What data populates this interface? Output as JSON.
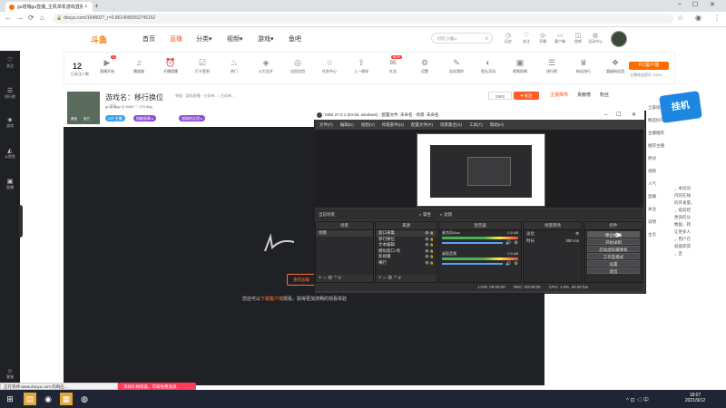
{
  "browser": {
    "tab_title": "gu塔瑞gu直播_主机单机游戏直播",
    "tab_close": "×",
    "new_tab": "+",
    "url": "douyu.com/164802?_r=0.8614950552745152",
    "win_min": "–",
    "win_max": "☐",
    "win_close": "✕"
  },
  "sidebar": {
    "items": [
      {
        "label": "关注",
        "icon": "heart-icon"
      },
      {
        "label": "排行榜",
        "icon": "rank-icon"
      },
      {
        "label": "游戏",
        "icon": "game-icon"
      },
      {
        "label": "斗鱼鱼",
        "icon": "fish-icon"
      },
      {
        "label": "直播",
        "icon": "live-icon"
      },
      {
        "label": "客服",
        "icon": "service-icon"
      }
    ]
  },
  "header": {
    "logo": "斗鱼",
    "nav": [
      "首页",
      "直播",
      "分类▾",
      "视频▾",
      "游戏▾",
      "鱼吧"
    ],
    "search_placeholder": "好吃小雅ω",
    "icons": [
      {
        "label": "历史",
        "icon": "history-icon"
      },
      {
        "label": "关注",
        "icon": "follow-icon"
      },
      {
        "label": "开播",
        "icon": "broadcast-icon"
      },
      {
        "label": "客户端",
        "icon": "client-icon"
      },
      {
        "label": "鱼吧",
        "icon": "bar-icon"
      },
      {
        "label": "活动中心",
        "icon": "activity-icon"
      }
    ]
  },
  "category_bar": {
    "count": "12",
    "count_caption": "已关注人数",
    "items": [
      {
        "label": "直播开始",
        "badge": "2"
      },
      {
        "label": "播放器",
        "badge": ""
      },
      {
        "label": "开播提醒",
        "badge": ""
      },
      {
        "label": "打卡签到",
        "badge": ""
      },
      {
        "label": "热门",
        "badge": ""
      },
      {
        "label": "火力全开",
        "badge": ""
      },
      {
        "label": "全民应用",
        "badge": ""
      },
      {
        "label": "任务中心",
        "badge": ""
      },
      {
        "label": "上一周排",
        "badge": ""
      },
      {
        "label": "礼包",
        "badge": "NEW"
      },
      {
        "label": "设置",
        "badge": ""
      },
      {
        "label": "告诉我你",
        "badge": ""
      },
      {
        "label": "鱼丸活动",
        "badge": ""
      },
      {
        "label": "视频投稿",
        "badge": ""
      },
      {
        "label": "排行榜",
        "badge": ""
      },
      {
        "label": "粉丝排行",
        "badge": ""
      },
      {
        "label": "超级粉丝团",
        "badge": ""
      }
    ],
    "pc_button": "PC客户端",
    "pc_sub": "主播收益提升 200%"
  },
  "room": {
    "title": "游戏名：移行换位",
    "meta": "举报 · 游戏直播 › 主机单... › 主机单...",
    "tagline": "gu塔瑞gu  ◎ 6400  ♡ 270.4kg",
    "avatar_tags": [
      "原创",
      "官方"
    ],
    "badges": [
      "VIP 主播",
      "捐献勋章 ▸",
      "超级粉丝团 ▸"
    ],
    "fans": "2902",
    "follow": "♥ 关注"
  },
  "player": {
    "reload": "重新加载",
    "tip_prefix": "您还可以",
    "tip_link": "下载客户端",
    "tip_suffix": "观看，获得更加流畅的观看体验",
    "promo": "添加礼物惊喜，可拿免费道具"
  },
  "right_panel": {
    "tabs": [
      "主播推荐",
      "贡献榜",
      "粉丝"
    ],
    "lines": [
      "土豪排行",
      "精选好礼",
      "主播推荐",
      "推荐主播",
      "原创",
      "视频",
      "人气",
      "直播",
      "关注",
      "说明",
      "主页"
    ],
    "text_snippets": [
      "，本房间",
      "内的在线",
      "的开发量，",
      "，提前结",
      "更高的分",
      "数据，转",
      "让更多人",
      "，用户在",
      "就能获得",
      "，且"
    ],
    "sponsor": "挂机"
  },
  "obs": {
    "title": "OBS 27.0.1 (64-bit, windows) - 配置文件: 未命名 - 场景: 未命名",
    "menu": [
      "文件(F)",
      "编辑(E)",
      "视图(V)",
      "停靠部件(D)",
      "配置文件(P)",
      "场景集合(S)",
      "工具(T)",
      "帮助(H)"
    ],
    "preview_label": "当前场景",
    "preview_tools": [
      "◐ 属性",
      "◐ 滤镜"
    ],
    "scenes_header": "场景",
    "scenes": [
      "场景"
    ],
    "sources_header": "来源",
    "sources": [
      "窗口采集",
      "移行换位",
      "文本编辑",
      "模拟窗口-场",
      "影视播",
      "横行"
    ],
    "mixer_header": "混音器",
    "mixer": [
      {
        "name": "麦克风/Aux",
        "db": "0.0 dB"
      },
      {
        "name": "桌面音频",
        "db": "0.0 dB"
      }
    ],
    "transitions_header": "场景转场",
    "transition_type": "淡化",
    "duration_label": "时长",
    "duration_value": "300 ms",
    "controls_header": "控件",
    "controls": [
      "停止推流",
      "开始录制",
      "启动虚拟摄像机",
      "工作室模式",
      "设置",
      "退出"
    ],
    "dock_foot": "+ – ⚙ ^ v",
    "status": [
      "LIVE: 00:00:00",
      "REC: 00:00:00",
      "CPU: 1.0%, 30.00 fps"
    ]
  },
  "chrome_status": "正在等待 www.douyu.com 的响应...",
  "taskbar": {
    "time": "18:07",
    "date": "2021/9/12",
    "tray": "^  ⊡  ◁  中"
  },
  "colors": {
    "brand": "#ff5d23",
    "obs_bg": "#3b3b3d",
    "player_bg": "#202124"
  }
}
